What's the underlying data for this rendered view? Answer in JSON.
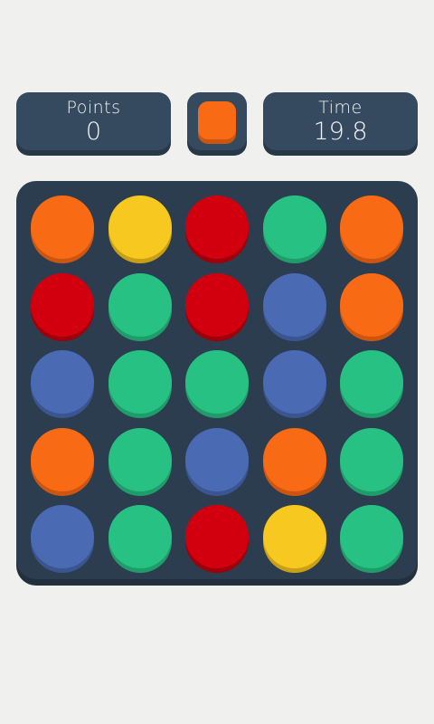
{
  "score": {
    "label": "Points",
    "value": "0"
  },
  "target": {
    "color": "#f96a14",
    "shadow": "#cc5510"
  },
  "timer": {
    "label": "Time",
    "value": "19.8"
  },
  "palette": {
    "orange": {
      "fill": "#f96a14",
      "shadow": "#cc5510"
    },
    "yellow": {
      "fill": "#f7c81f",
      "shadow": "#c9a015"
    },
    "red": {
      "fill": "#d2000f",
      "shadow": "#9e000b"
    },
    "green": {
      "fill": "#27c283",
      "shadow": "#1f9c69"
    },
    "blue": {
      "fill": "#4a6bb4",
      "shadow": "#3a5590"
    }
  },
  "grid": [
    [
      "orange",
      "yellow",
      "red",
      "green",
      "orange"
    ],
    [
      "red",
      "green",
      "red",
      "blue",
      "orange"
    ],
    [
      "blue",
      "green",
      "green",
      "blue",
      "green"
    ],
    [
      "orange",
      "green",
      "blue",
      "orange",
      "green"
    ],
    [
      "blue",
      "green",
      "red",
      "yellow",
      "green"
    ]
  ]
}
